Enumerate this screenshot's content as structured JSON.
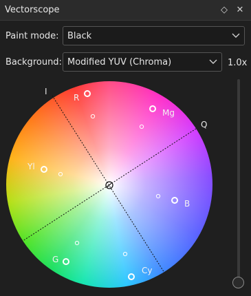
{
  "window": {
    "title": "Vectorscope"
  },
  "titlebar_icons": {
    "float": "diamond-icon",
    "close": "close-icon"
  },
  "paint_mode": {
    "label": "Paint mode:",
    "value": "Black"
  },
  "background": {
    "label": "Background:",
    "value": "Modified YUV (Chroma)"
  },
  "zoom": {
    "value": "1.0x"
  },
  "scope": {
    "axis_labels": {
      "i": "I",
      "q": "Q"
    },
    "targets": [
      {
        "name": "R",
        "label": "R"
      },
      {
        "name": "Mg",
        "label": "Mg"
      },
      {
        "name": "Yl",
        "label": "Yl"
      },
      {
        "name": "B",
        "label": "B"
      },
      {
        "name": "G",
        "label": "G"
      },
      {
        "name": "Cy",
        "label": "Cy"
      }
    ]
  }
}
